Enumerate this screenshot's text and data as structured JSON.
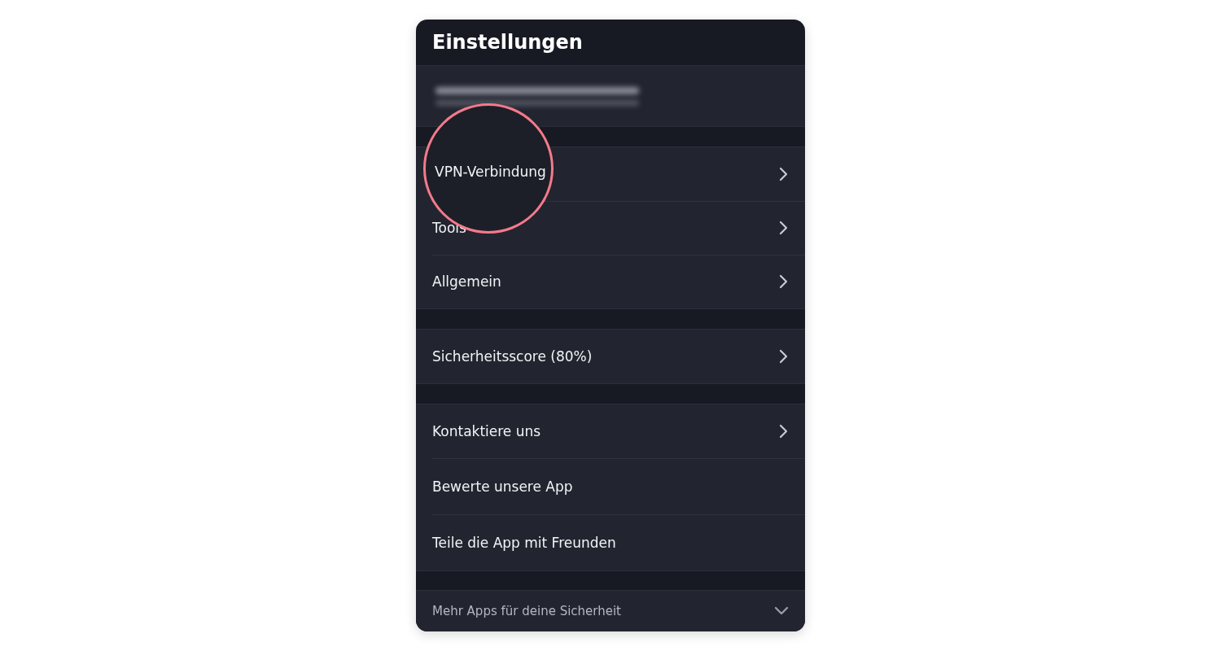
{
  "header": {
    "title": "Einstellungen"
  },
  "account": {
    "blurred": true
  },
  "groups": [
    {
      "items": [
        {
          "label": "VPN-Verbindung",
          "kind": "submenu",
          "highlighted": true
        },
        {
          "label": "Tools",
          "kind": "submenu",
          "highlighted": false
        },
        {
          "label": "Allgemein",
          "kind": "submenu",
          "highlighted": false
        }
      ]
    },
    {
      "items": [
        {
          "label": "Sicherheitsscore (80%)",
          "kind": "submenu",
          "highlighted": false
        }
      ]
    },
    {
      "items": [
        {
          "label": "Kontaktiere uns",
          "kind": "submenu",
          "highlighted": false
        },
        {
          "label": "Bewerte unsere App",
          "kind": "action",
          "highlighted": false
        },
        {
          "label": "Teile die App mit Freunden",
          "kind": "action",
          "highlighted": false
        }
      ]
    }
  ],
  "footer": {
    "label": "Mehr Apps für deine Sicherheit",
    "expanded": false
  }
}
